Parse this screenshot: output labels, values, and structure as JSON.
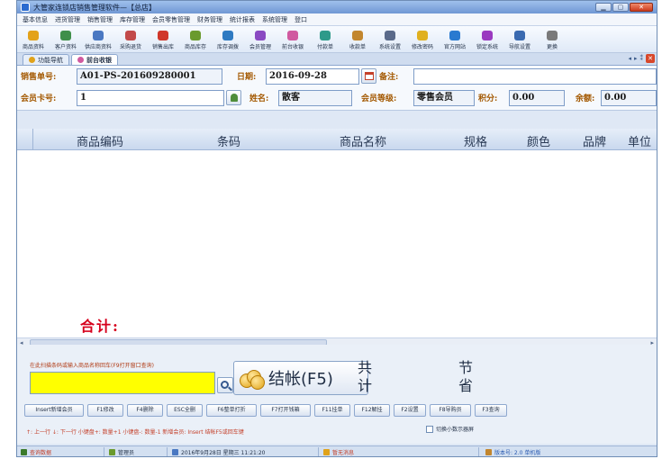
{
  "window": {
    "title": "大管家连锁店销售管理软件—【总店】"
  },
  "menu": [
    "基本信息",
    "进货管理",
    "销售管理",
    "库存管理",
    "会员零售管理",
    "财务管理",
    "统计报表",
    "系统管理",
    "登口"
  ],
  "toolbar": [
    {
      "label": "商品资料",
      "icon": "goods-icon",
      "color": "#e3a21a"
    },
    {
      "label": "客户资料",
      "icon": "customer-icon",
      "color": "#3f8f4a"
    },
    {
      "label": "供应商资料",
      "icon": "supplier-icon",
      "color": "#4a78c2"
    },
    {
      "label": "采购退货",
      "icon": "purchase-return-icon",
      "color": "#c24a4a"
    },
    {
      "label": "销售出库",
      "icon": "sales-outbound-icon",
      "color": "#d0372a"
    },
    {
      "label": "商品库存",
      "icon": "inventory-icon",
      "color": "#6a9a2e"
    },
    {
      "label": "库存调拨",
      "icon": "transfer-icon",
      "color": "#2e7ac2"
    },
    {
      "label": "会员管理",
      "icon": "member-icon",
      "color": "#8a4ac2"
    },
    {
      "label": "前台收银",
      "icon": "cashier-icon",
      "color": "#d05aa0"
    },
    {
      "label": "付款单",
      "icon": "payment-icon",
      "color": "#2e9a8a"
    },
    {
      "label": "收款单",
      "icon": "receipt-icon",
      "color": "#c2862e"
    },
    {
      "label": "系统设置",
      "icon": "settings-icon",
      "color": "#5a6a8a"
    },
    {
      "label": "修改密码",
      "icon": "password-icon",
      "color": "#e0b020"
    },
    {
      "label": "官方网站",
      "icon": "website-icon",
      "color": "#2a7ad0"
    },
    {
      "label": "锁定系统",
      "icon": "lock-icon",
      "color": "#9a3ac0"
    },
    {
      "label": "导航设置",
      "icon": "nav-settings-icon",
      "color": "#3a6ab0"
    },
    {
      "label": "更换",
      "icon": "switch-icon",
      "color": "#7a7a7a"
    }
  ],
  "tabs": [
    {
      "label": "功能导航",
      "active": false
    },
    {
      "label": "前台收银",
      "active": true
    }
  ],
  "form": {
    "order_no_label": "销售单号:",
    "order_no": "A01-PS-201609280001",
    "date_label": "日期:",
    "date": "2016-09-28",
    "remark_label": "备注:",
    "remark": "",
    "member_card_label": "会员卡号:",
    "member_card": "1",
    "name_label": "姓名:",
    "name": "散客",
    "level_label": "会员等级:",
    "level": "零售会员",
    "points_label": "积分:",
    "points": "0.00",
    "balance_label": "余额:",
    "balance": "0.00"
  },
  "grid": {
    "columns": [
      "商品编码",
      "条码",
      "商品名称",
      "规格",
      "颜色",
      "品牌",
      "单位"
    ],
    "total_label": "合计:"
  },
  "bottom": {
    "scan_hint": "在此扫描条码或输入商品名称回车(F9打开窗口查询)",
    "scan_value": "",
    "checkout_label": "结帐(F5)",
    "total_count_label": "共计",
    "saved_label": "节省",
    "keys": [
      "Insert新增会员",
      "F1修改",
      "F4删除",
      "ESC全删",
      "F6整单打折",
      "F7打开钱箱",
      "F11挂单",
      "F12解挂",
      "F2设置",
      "F8导购员",
      "F3查询"
    ],
    "shortcuts": "↑: 上一行    ↓: 下一行    小键盘+: 数量+1    小键盘-: 数量-1    新增会员: Insert    结帐F5或回车键",
    "toggle_label": "切换小数示器屏"
  },
  "status": {
    "operator": "查询数据",
    "user": "管理员",
    "datetime": "2016年9月28日  星期三    11:21:20",
    "message": "暂无消息",
    "version": "版本号: 2.0  单机版"
  },
  "colors": {
    "accent": "#a35800",
    "total": "#d6001c",
    "scan_box": "#ffff00"
  }
}
